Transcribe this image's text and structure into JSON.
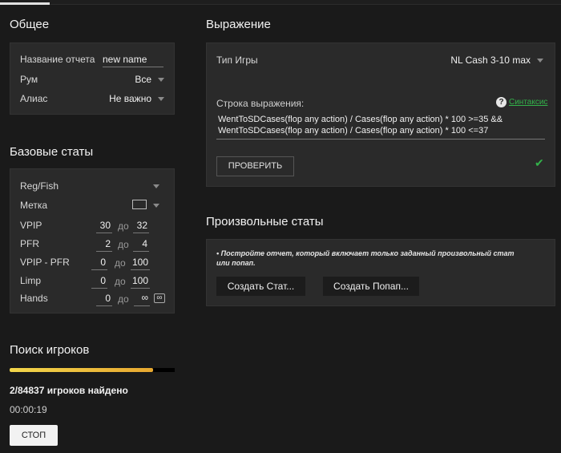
{
  "general": {
    "title": "Общее",
    "report_name_label": "Название отчета",
    "report_name_value": "new name",
    "room_label": "Рум",
    "room_value": "Все",
    "alias_label": "Алиас",
    "alias_value": "Не важно"
  },
  "base_stats": {
    "title": "Базовые статы",
    "regfish_label": "Reg/Fish",
    "mark_label": "Метка",
    "range_sep": "до",
    "rows": [
      {
        "label": "VPIP",
        "from": "30",
        "to": "32"
      },
      {
        "label": "PFR",
        "from": "2",
        "to": "4"
      },
      {
        "label": "VPIP - PFR",
        "from": "0",
        "to": "100"
      },
      {
        "label": "Limp",
        "from": "0",
        "to": "100"
      },
      {
        "label": "Hands",
        "from": "0",
        "to": "∞",
        "infinity_toggle": "∞"
      }
    ]
  },
  "search": {
    "title": "Поиск игроков",
    "progress": 0.87,
    "found_text": "2/84837 игроков найдено",
    "elapsed": "00:00:19",
    "stop_label": "СТОП"
  },
  "expression": {
    "title": "Выражение",
    "game_type_label": "Тип Игры",
    "game_type_value": "NL Cash 3-10 max",
    "expr_label": "Строка выражения:",
    "help_glyph": "?",
    "syntax_link": "Синтаксис",
    "expr_line1": "WentToSDCases(flop any action) / Cases(flop any action) * 100 >=35 &&",
    "expr_line2": "WentToSDCases(flop any action) / Cases(flop any action) * 100 <=37",
    "check_label": "ПРОВЕРИТЬ",
    "valid_glyph": "✔"
  },
  "custom_stats": {
    "title": "Произвольные статы",
    "note_line1": "• Постройте отчет, который включает только заданный произвольный стат",
    "note_line2": "или попап.",
    "create_stat_label": "Создать Стат...",
    "create_popup_label": "Создать Попап..."
  },
  "colors": {
    "accent_green": "#33b24a",
    "progress_start": "#f2d64b",
    "progress_end": "#e8a830"
  }
}
